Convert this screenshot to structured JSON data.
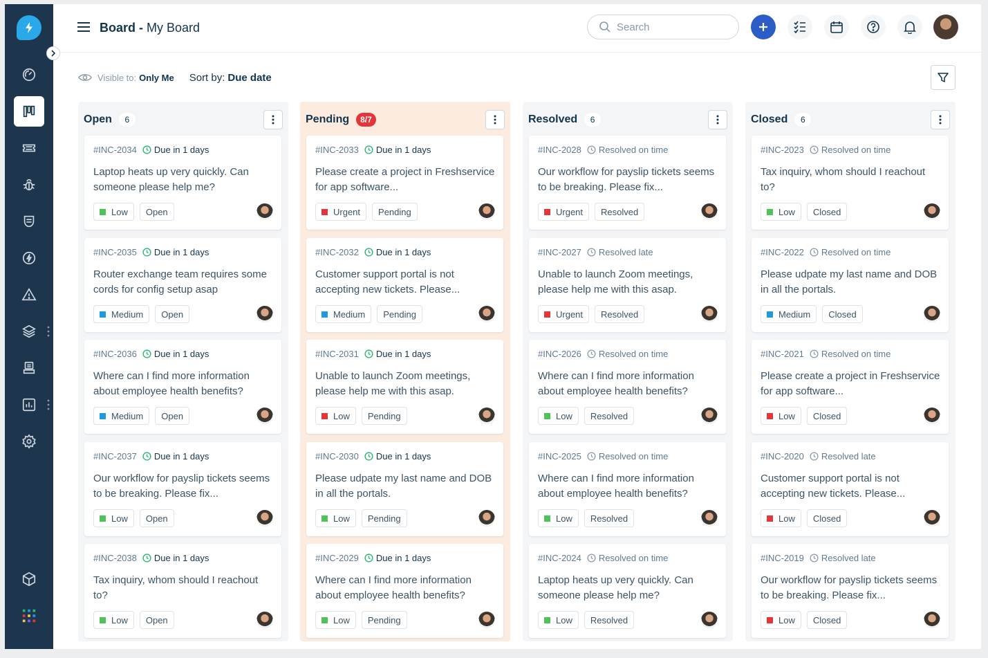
{
  "header": {
    "title_bold": "Board",
    "title_sep": " - ",
    "title_rest": "My Board",
    "search_placeholder": "Search"
  },
  "toolbar": {
    "visible_label": "Visible to:",
    "visible_value": "Only Me",
    "sort_label": "Sort by:",
    "sort_value": "Due date"
  },
  "columns": [
    {
      "title": "Open",
      "count": "6",
      "cards": [
        {
          "id": "#INC-2034",
          "status_text": "Due in 1 days",
          "text": "Laptop heats up very quickly. Can someone please help me?",
          "priority": "Low",
          "priority_color": "#4fc35a",
          "state": "Open"
        },
        {
          "id": "#INC-2035",
          "status_text": "Due in 1 days",
          "text": "Router exchange team requires some cords for config setup asap",
          "priority": "Medium",
          "priority_color": "#1e9be0",
          "state": "Open"
        },
        {
          "id": "#INC-2036",
          "status_text": "Due in 1 days",
          "text": "Where can I find more information about employee health benefits?",
          "priority": "Medium",
          "priority_color": "#1e9be0",
          "state": "Open"
        },
        {
          "id": "#INC-2037",
          "status_text": "Due in 1 days",
          "text": "Our workflow for payslip tickets seems to be breaking. Please fix...",
          "priority": "Low",
          "priority_color": "#4fc35a",
          "state": "Open"
        },
        {
          "id": "#INC-2038",
          "status_text": "Due in 1 days",
          "text": "Tax inquiry, whom should I reachout to?",
          "priority": "Low",
          "priority_color": "#4fc35a",
          "state": "Open"
        }
      ]
    },
    {
      "title": "Pending",
      "count": "8/7",
      "cards": [
        {
          "id": "#INC-2033",
          "status_text": "Due in 1 days",
          "text": "Please create a project in Freshservice for app software...",
          "priority": "Urgent",
          "priority_color": "#e43538",
          "state": "Pending"
        },
        {
          "id": "#INC-2032",
          "status_text": "Due in 1 days",
          "text": "Customer support portal is not accepting new tickets. Please...",
          "priority": "Medium",
          "priority_color": "#1e9be0",
          "state": "Pending"
        },
        {
          "id": "#INC-2031",
          "status_text": "Due in 1 days",
          "text": "Unable to launch Zoom meetings, please help me with this asap.",
          "priority": "Low",
          "priority_color": "#e43538",
          "state": "Pending"
        },
        {
          "id": "#INC-2030",
          "status_text": "Due in 1 days",
          "text": "Please udpate my last name and DOB in all the portals.",
          "priority": "Low",
          "priority_color": "#4fc35a",
          "state": "Pending"
        },
        {
          "id": "#INC-2029",
          "status_text": "Due in 1 days",
          "text": "Where can I find more information about employee health benefits?",
          "priority": "Low",
          "priority_color": "#4fc35a",
          "state": "Pending"
        }
      ]
    },
    {
      "title": "Resolved",
      "count": "6",
      "cards": [
        {
          "id": "#INC-2028",
          "status_text": "Resolved on time",
          "text": "Our workflow for payslip tickets seems to be breaking. Please fix...",
          "priority": "Urgent",
          "priority_color": "#e43538",
          "state": "Resolved"
        },
        {
          "id": "#INC-2027",
          "status_text": "Resolved late",
          "text": "Unable to launch Zoom meetings, please help me with this asap.",
          "priority": "Urgent",
          "priority_color": "#e43538",
          "state": "Resolved"
        },
        {
          "id": "#INC-2026",
          "status_text": "Resolved on time",
          "text": "Where can I find more information about employee health benefits?",
          "priority": "Low",
          "priority_color": "#4fc35a",
          "state": "Resolved"
        },
        {
          "id": "#INC-2025",
          "status_text": "Resolved on time",
          "text": "Where can I find more information about employee health benefits?",
          "priority": "Low",
          "priority_color": "#4fc35a",
          "state": "Resolved"
        },
        {
          "id": "#INC-2024",
          "status_text": "Resolved on time",
          "text": "Laptop heats up very quickly. Can someone please help me?",
          "priority": "Low",
          "priority_color": "#4fc35a",
          "state": "Resolved"
        }
      ]
    },
    {
      "title": "Closed",
      "count": "6",
      "cards": [
        {
          "id": "#INC-2023",
          "status_text": "Resolved on time",
          "text": "Tax inquiry, whom should I reachout to?",
          "priority": "Low",
          "priority_color": "#4fc35a",
          "state": "Closed"
        },
        {
          "id": "#INC-2022",
          "status_text": "Resolved on time",
          "text": "Please udpate my last name and DOB in all the portals.",
          "priority": "Medium",
          "priority_color": "#1e9be0",
          "state": "Closed"
        },
        {
          "id": "#INC-2021",
          "status_text": "Resolved on time",
          "text": "Please create a project in Freshservice for app software...",
          "priority": "Low",
          "priority_color": "#e43538",
          "state": "Closed"
        },
        {
          "id": "#INC-2020",
          "status_text": "Resolved late",
          "text": "Customer support portal is not accepting new tickets. Please...",
          "priority": "Low",
          "priority_color": "#e43538",
          "state": "Closed"
        },
        {
          "id": "#INC-2019",
          "status_text": "Resolved late",
          "text": "Our workflow for payslip tickets seems to be breaking. Please fix...",
          "priority": "Low",
          "priority_color": "#e43538",
          "state": "Closed"
        }
      ]
    }
  ]
}
